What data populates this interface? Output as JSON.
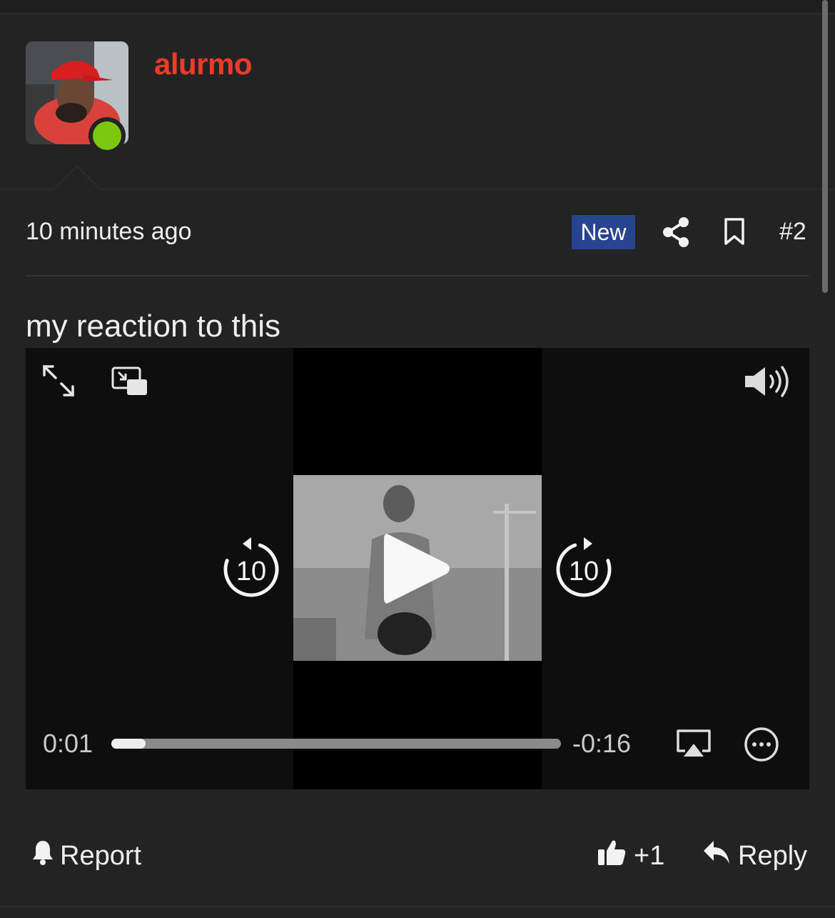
{
  "post": {
    "author": "alurmo",
    "timestamp": "10 minutes ago",
    "badge": "New",
    "post_number": "#2",
    "body": "my reaction to this"
  },
  "video": {
    "elapsed": "0:01",
    "remaining": "-0:16",
    "progress_fraction": 0.076,
    "skip_back_seconds": "10",
    "skip_forward_seconds": "10"
  },
  "actions": {
    "report_label": "Report",
    "like_label": "+1",
    "reply_label": "Reply"
  },
  "colors": {
    "username": "#f0392b",
    "online": "#7dc70f",
    "badge_bg": "#28438f"
  },
  "icons": [
    "share-icon",
    "bookmark-icon",
    "fullscreen-icon",
    "picture-in-picture-icon",
    "volume-icon",
    "skip-back-icon",
    "play-icon",
    "skip-forward-icon",
    "airplay-icon",
    "more-options-icon",
    "bell-icon",
    "thumbs-up-icon",
    "reply-icon"
  ]
}
